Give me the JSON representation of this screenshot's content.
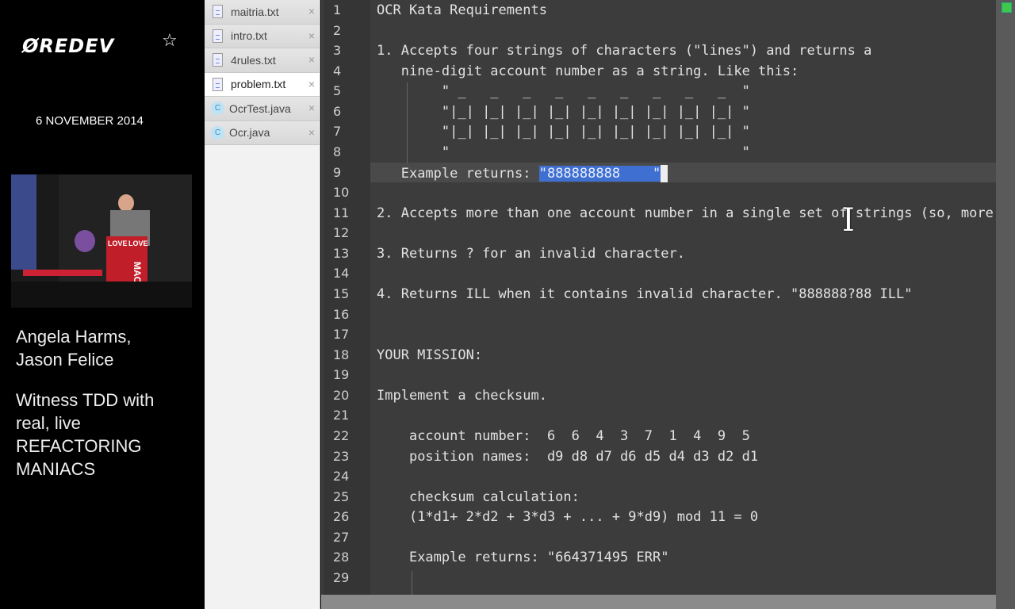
{
  "left_panel": {
    "logo": "ØREDEV",
    "date": "6 NOVEMBER 2014",
    "speakers": [
      "Angela Harms,",
      "Jason  Felice"
    ],
    "talk_title": [
      "Witness TDD with",
      "real, live",
      "REFACTORING",
      "MANIACS"
    ],
    "video_signs": [
      "LOVE",
      "LOVE",
      "MAC"
    ]
  },
  "files": [
    {
      "name": "maitria.txt",
      "type": "text",
      "active": false
    },
    {
      "name": "intro.txt",
      "type": "text",
      "active": false
    },
    {
      "name": "4rules.txt",
      "type": "text",
      "active": false
    },
    {
      "name": "problem.txt",
      "type": "text",
      "active": true
    },
    {
      "name": "OcrTest.java",
      "type": "java",
      "active": false
    },
    {
      "name": "Ocr.java",
      "type": "java",
      "active": false
    }
  ],
  "close_glyph": "×",
  "editor": {
    "lines": [
      "OCR Kata Requirements",
      "",
      "1. Accepts four strings of characters (\"lines\") and returns a",
      "   nine-digit account number as a string. Like this:",
      "        \" _   _   _   _   _   _   _   _   _  \"",
      "        \"|_| |_| |_| |_| |_| |_| |_| |_| |_| \"",
      "        \"|_| |_| |_| |_| |_| |_| |_| |_| |_| \"",
      "        \"                                    \"",
      "   Example returns: ",
      "",
      "2. Accepts more than one account number in a single set of strings (so, more",
      "",
      "3. Returns ? for an invalid character.",
      "",
      "4. Returns ILL when it contains invalid character. \"888888?88 ILL\"",
      "",
      "",
      "YOUR MISSION:",
      "",
      "Implement a checksum.",
      "",
      "    account number:  6  6  4  3  7  1  4  9  5",
      "    position names:  d9 d8 d7 d6 d5 d4 d3 d2 d1",
      "",
      "    checksum calculation:",
      "    (1*d1+ 2*d2 + 3*d3 + ... + 9*d9) mod 11 = 0",
      "",
      "    Example returns: \"664371495 ERR\"",
      ""
    ],
    "selected_text": "\"888888888    \"",
    "current_line": 9
  }
}
